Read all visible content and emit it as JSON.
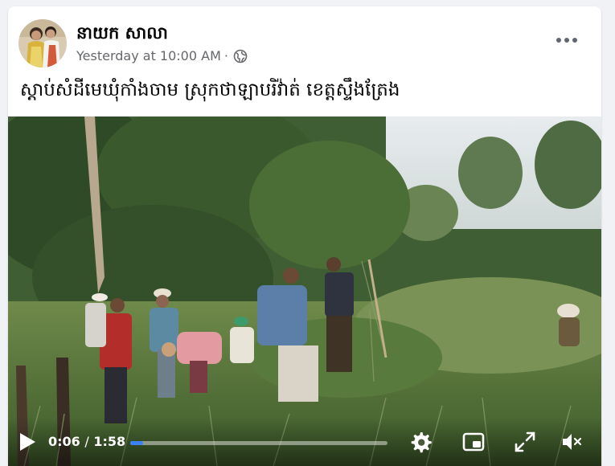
{
  "post": {
    "author": "នាយក សាលា",
    "timestamp": "Yesterday at 10:00 AM",
    "separator": "·",
    "audience_icon": "globe-icon",
    "more_icon": "more-options-icon",
    "caption": "ស្តាប់សំដីមេឃុំកាំងចាម ស្រុកថាឡាបរិវ៉ាត់ ខេត្តស្ទឹងត្រែង"
  },
  "video": {
    "current_time": "0:06",
    "time_separator": "/",
    "duration": "1:58",
    "progress_fraction": 0.05,
    "icons": {
      "play": "play-icon",
      "settings": "gear-icon",
      "pip": "picture-in-picture-icon",
      "fullscreen": "fullscreen-icon",
      "mute": "mute-icon"
    }
  },
  "colors": {
    "page_background": "#f0f2f5",
    "card_background": "#ffffff",
    "author_text": "#050505",
    "meta_text": "#65676b",
    "progress_fill": "#3b82f6"
  }
}
